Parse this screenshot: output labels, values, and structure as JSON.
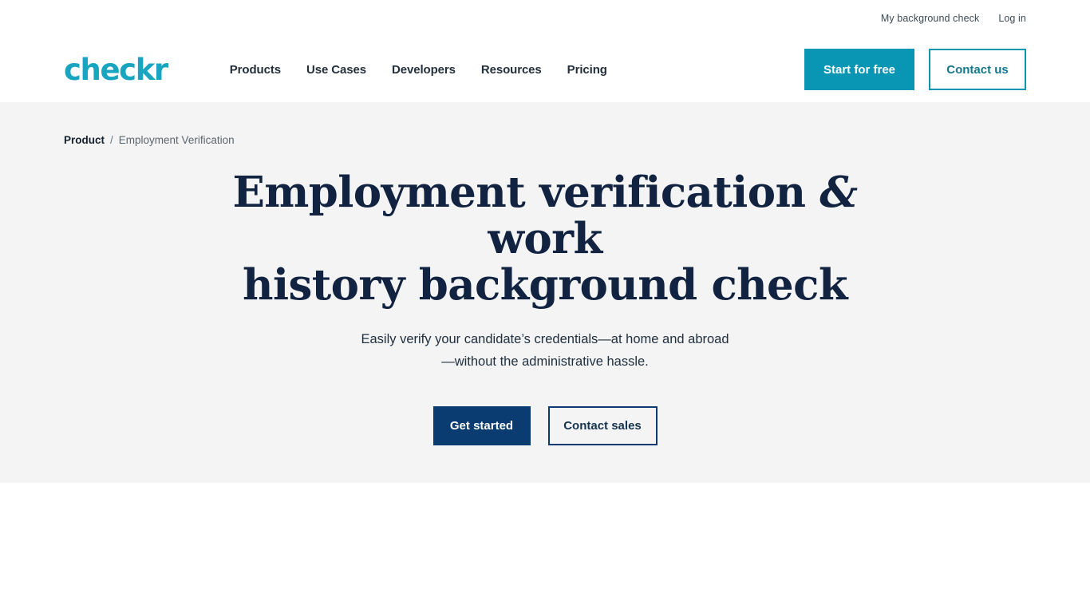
{
  "utility": {
    "links": [
      {
        "label": "My background check"
      },
      {
        "label": "Log in"
      }
    ]
  },
  "header": {
    "logo_text": "checkr",
    "logo_color": "#19A5C0",
    "nav": [
      {
        "label": "Products"
      },
      {
        "label": "Use Cases"
      },
      {
        "label": "Developers"
      },
      {
        "label": "Resources"
      },
      {
        "label": "Pricing"
      }
    ],
    "primary_cta": "Start for free",
    "secondary_cta": "Contact us"
  },
  "breadcrumb": {
    "root": "Product",
    "separator": "/",
    "current": "Employment Verification"
  },
  "hero": {
    "title_line1_a": "Employment verification ",
    "title_amp": "&",
    "title_line1_b": " work",
    "title_line2": "history background check",
    "subtitle_line1": "Easily verify your candidate’s credentials—at home and",
    "subtitle_line2": "abroad—without the administrative hassle.",
    "primary_cta": "Get started",
    "secondary_cta": "Contact sales",
    "background_color": "#f4f4f4",
    "title_color": "#112340",
    "navy_color": "#0A3C72"
  }
}
